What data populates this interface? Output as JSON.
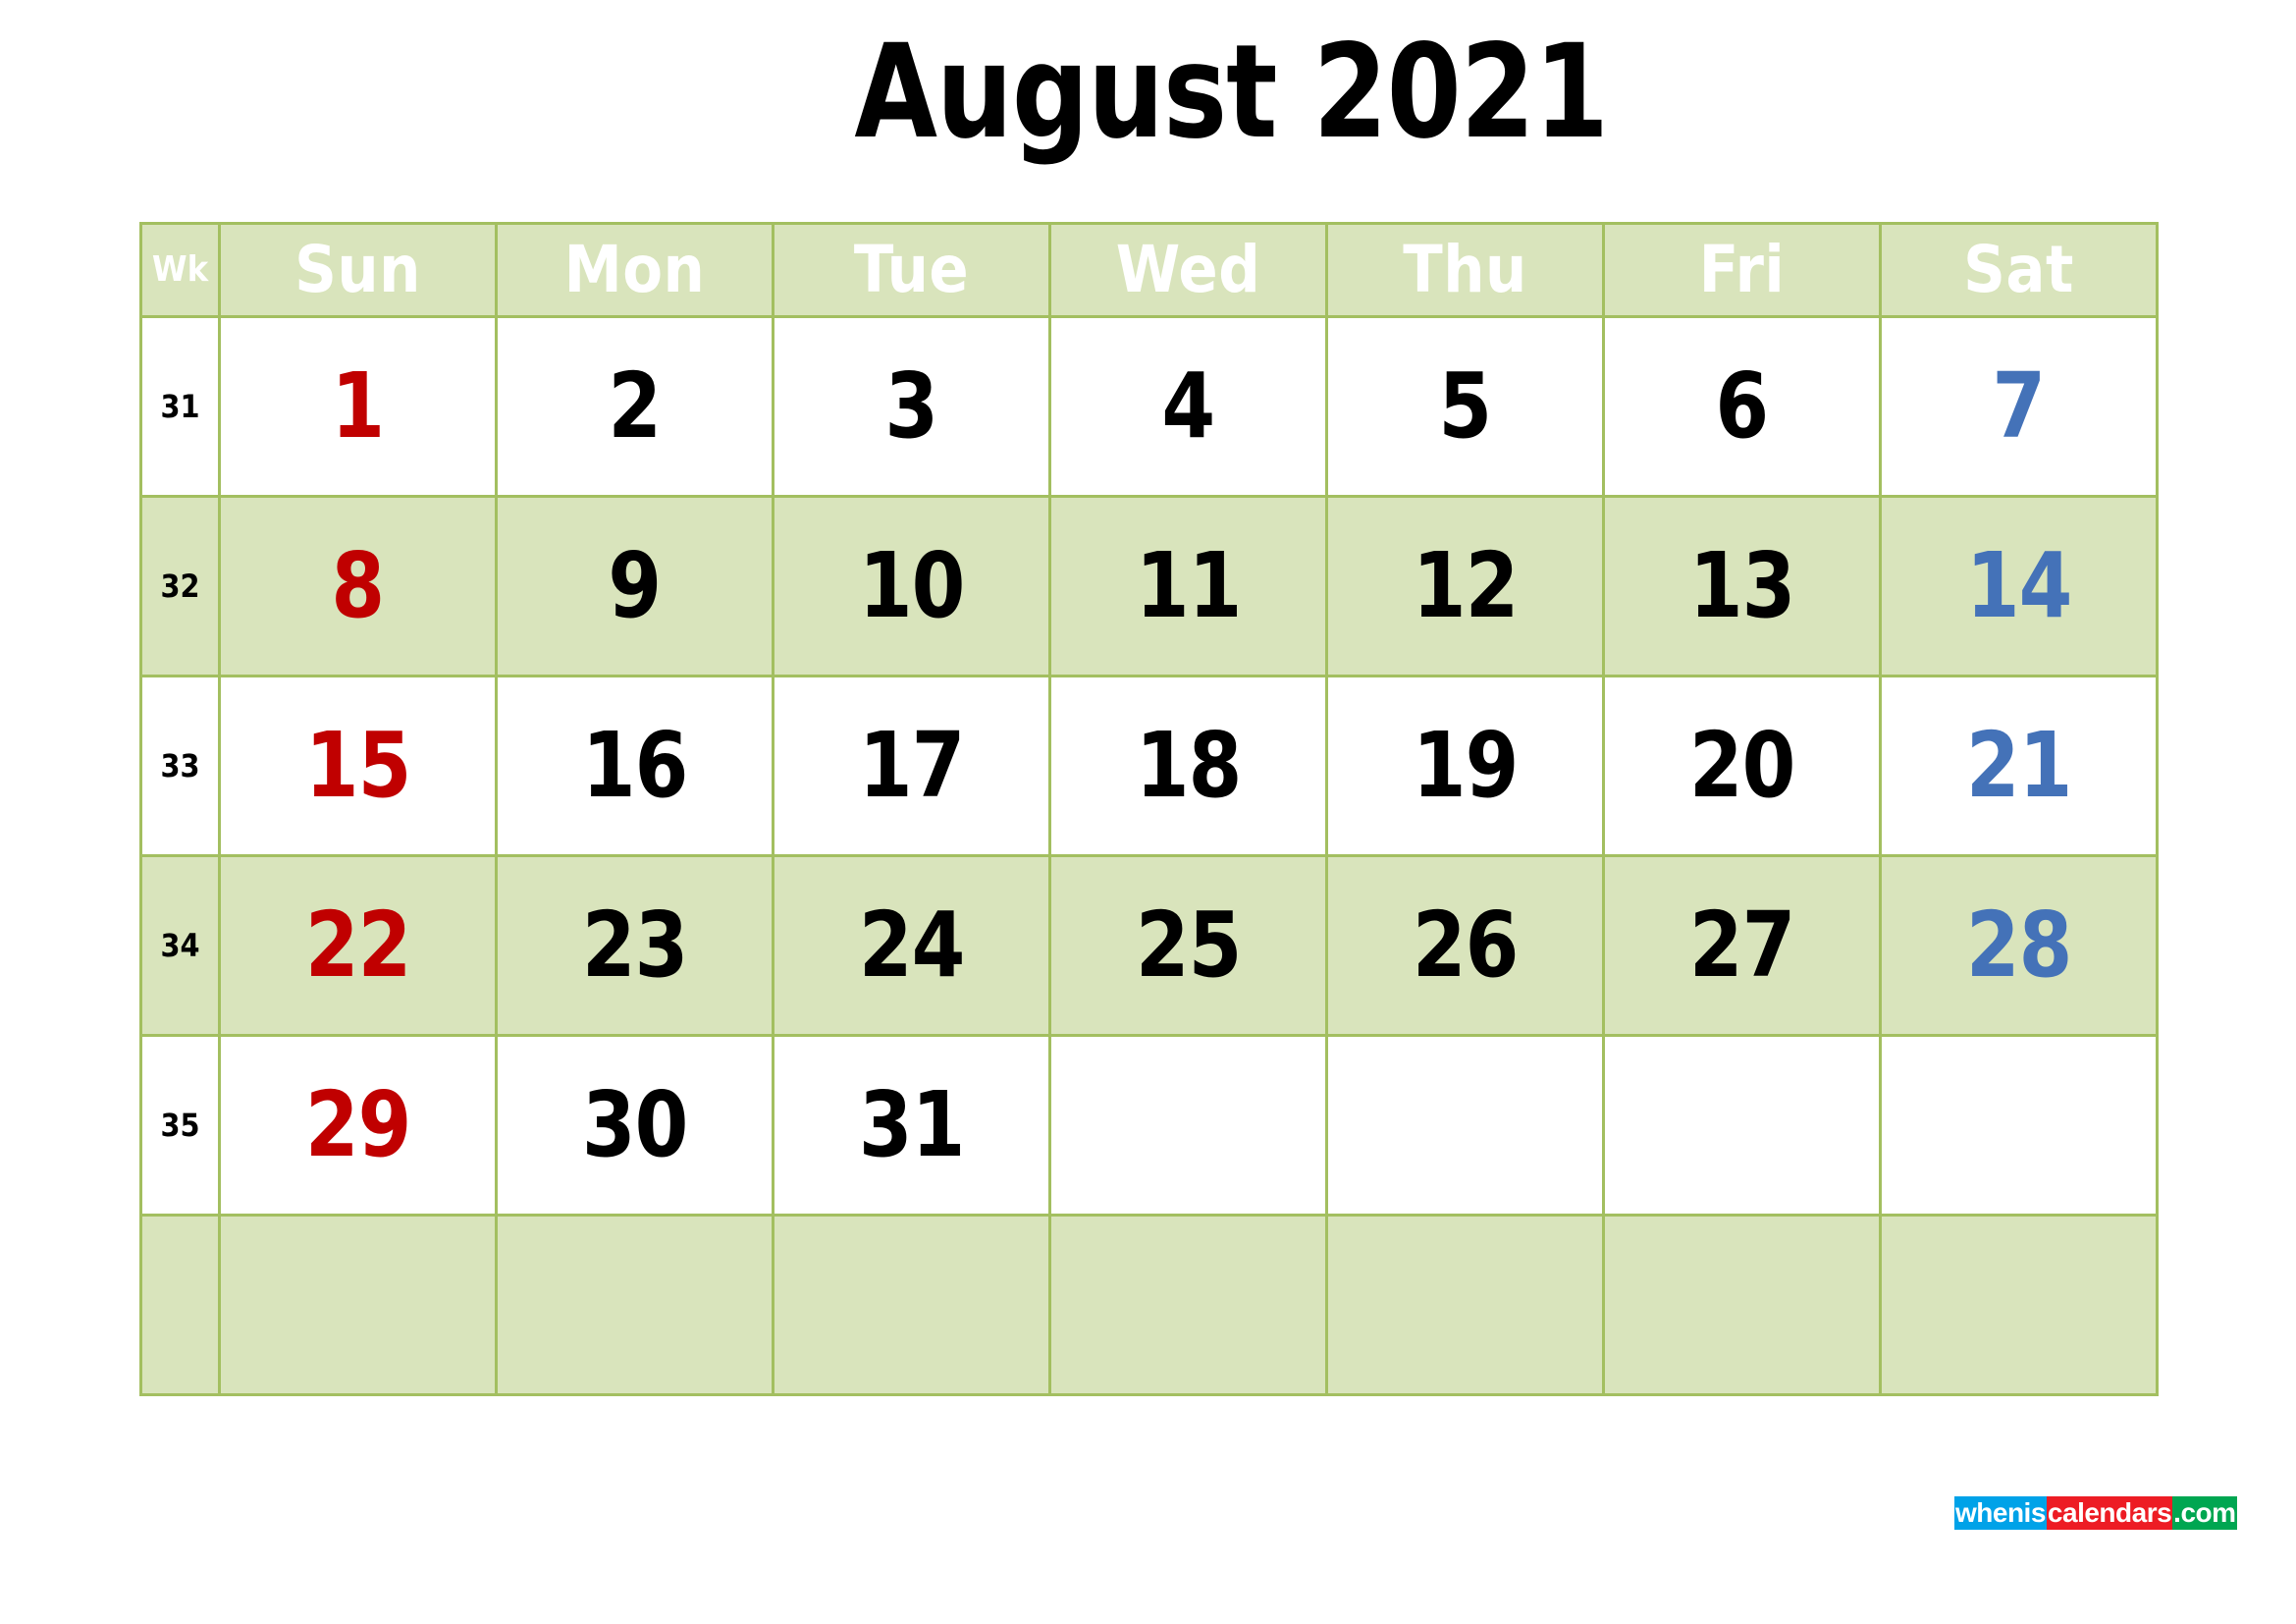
{
  "page": {
    "title": "August 2021",
    "month": "August",
    "year": "2021"
  },
  "colors": {
    "header_bg": "#d9e4bc",
    "row_alt_bg": "#d9e4bc",
    "row_bg": "#ffffff",
    "border": "#a3bf60",
    "sunday_text": "#c00000",
    "saturday_text": "#4472b8",
    "weekday_text": "#000000",
    "header_text": "#ffffff"
  },
  "calendar": {
    "week_column_header": "Wk",
    "day_headers": [
      "Sun",
      "Mon",
      "Tue",
      "Wed",
      "Thu",
      "Fri",
      "Sat"
    ],
    "weeks": [
      {
        "wk": "31",
        "shaded": false,
        "days": [
          "1",
          "2",
          "3",
          "4",
          "5",
          "6",
          "7"
        ]
      },
      {
        "wk": "32",
        "shaded": true,
        "days": [
          "8",
          "9",
          "10",
          "11",
          "12",
          "13",
          "14"
        ]
      },
      {
        "wk": "33",
        "shaded": false,
        "days": [
          "15",
          "16",
          "17",
          "18",
          "19",
          "20",
          "21"
        ]
      },
      {
        "wk": "34",
        "shaded": true,
        "days": [
          "22",
          "23",
          "24",
          "25",
          "26",
          "27",
          "28"
        ]
      },
      {
        "wk": "35",
        "shaded": false,
        "days": [
          "29",
          "30",
          "31",
          "",
          "",
          "",
          ""
        ]
      },
      {
        "wk": "",
        "shaded": true,
        "days": [
          "",
          "",
          "",
          "",
          "",
          "",
          ""
        ]
      }
    ]
  },
  "watermark": {
    "part1": "whenis",
    "part2": "calendars",
    "part3": ".com"
  }
}
